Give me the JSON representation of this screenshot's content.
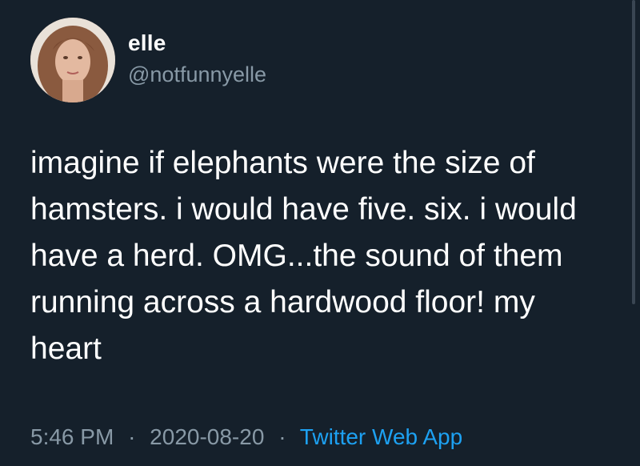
{
  "user": {
    "name": "elle",
    "handle": "@notfunnyelle",
    "avatar_icon": "profile-photo"
  },
  "tweet": {
    "lines": [
      "imagine if elephants were the size of",
      "hamsters. i would have five. six. i would",
      "have a herd. OMG...the sound of them",
      "running across a hardwood floor! my",
      "heart"
    ],
    "time": "5:46 PM",
    "separator": "·",
    "date": "2020-08-20",
    "source": "Twitter Web App"
  },
  "colors": {
    "background": "#15202b",
    "text": "#ffffff",
    "muted": "#8899a6",
    "link": "#1da1f2"
  }
}
